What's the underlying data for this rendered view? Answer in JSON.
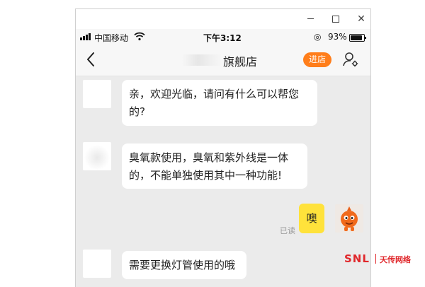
{
  "status_bar": {
    "carrier": "中国移动",
    "time": "下午3:12",
    "battery": "93%"
  },
  "nav": {
    "title": "旗舰店",
    "enter_store": "进店"
  },
  "messages": [
    {
      "side": "left",
      "text": "亲，欢迎光临，请问有什么可以帮您的?"
    },
    {
      "side": "left",
      "text": "臭氧款使用，臭氧和紫外线是一体的，不能单独使用其中一种功能!"
    },
    {
      "side": "right",
      "text": "噢",
      "status": "已读"
    },
    {
      "side": "left",
      "text": "需要更换灯管使用的哦"
    }
  ],
  "watermark": {
    "brand": "SNL",
    "name": "天传网络"
  },
  "colors": {
    "accent": "#ff7e1b",
    "own_bubble": "#ffe23b",
    "chat_background": "#ebebeb"
  }
}
